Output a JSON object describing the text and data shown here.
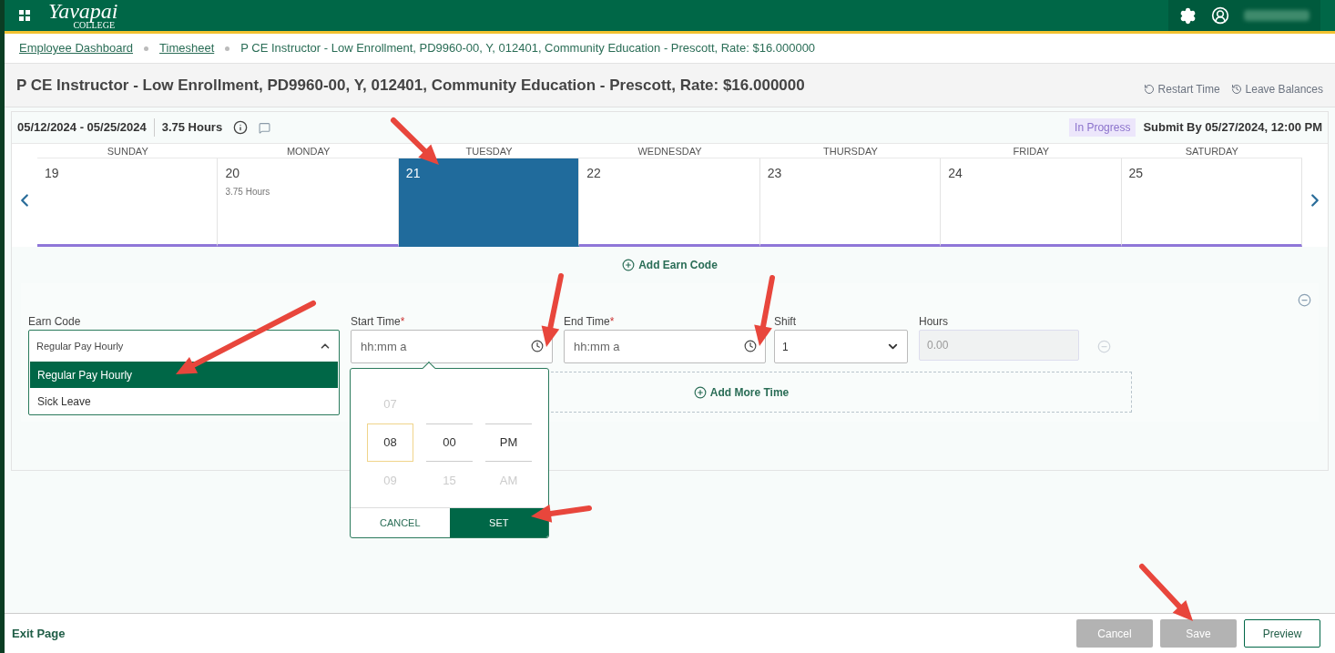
{
  "header": {
    "logo_main": "Yavapai",
    "logo_sub": "COLLEGE"
  },
  "breadcrumbs": [
    {
      "label": "Employee Dashboard",
      "link": true
    },
    {
      "label": "Timesheet",
      "link": true
    },
    {
      "label": "P CE Instructor - Low Enrollment, PD9960-00, Y, 012401, Community Education - Prescott, Rate: $16.000000",
      "link": false
    }
  ],
  "title": "P CE Instructor - Low Enrollment, PD9960-00, Y, 012401, Community Education - Prescott, Rate: $16.000000",
  "title_actions": [
    {
      "kind": "restart",
      "label": "Restart Time"
    },
    {
      "kind": "balances",
      "label": "Leave Balances"
    }
  ],
  "period": {
    "range": "05/12/2024 - 05/25/2024",
    "hours": "3.75 Hours",
    "status": "In Progress",
    "submit_by": "Submit By 05/27/2024, 12:00 PM"
  },
  "days": [
    {
      "weekday": "SUNDAY",
      "date": "19",
      "selected": false
    },
    {
      "weekday": "MONDAY",
      "date": "20",
      "hours": "3.75 Hours",
      "selected": false
    },
    {
      "weekday": "TUESDAY",
      "date": "21",
      "selected": true
    },
    {
      "weekday": "WEDNESDAY",
      "date": "22",
      "selected": false
    },
    {
      "weekday": "THURSDAY",
      "date": "23",
      "selected": false
    },
    {
      "weekday": "FRIDAY",
      "date": "24",
      "selected": false
    },
    {
      "weekday": "SATURDAY",
      "date": "25",
      "selected": false
    }
  ],
  "add_earn_code": "Add Earn Code",
  "earn_code": {
    "label": "Earn Code",
    "value": "Regular Pay Hourly",
    "expanded": true,
    "options": [
      {
        "label": "Regular Pay Hourly",
        "selected": true
      },
      {
        "label": "Sick Leave",
        "selected": false
      }
    ]
  },
  "start_time": {
    "label": "Start Time",
    "required_mark": "*",
    "placeholder": "hh:mm a"
  },
  "end_time": {
    "label": "End Time",
    "required_mark": "*",
    "placeholder": "hh:mm a"
  },
  "time_picker": {
    "columns": [
      [
        {
          "text": "07",
          "selected": false
        },
        {
          "text": "08",
          "selected": true
        },
        {
          "text": "09",
          "selected": false
        }
      ],
      [
        {
          "text": "00",
          "selected": true
        },
        {
          "text": "15",
          "selected": false
        }
      ],
      [
        {
          "text": "PM",
          "selected": true
        },
        {
          "text": "AM",
          "selected": false
        }
      ]
    ],
    "cancel": "CANCEL",
    "set": "SET"
  },
  "shift": {
    "label": "Shift",
    "value": "1"
  },
  "hours_field": {
    "label": "Hours",
    "value": "0.00",
    "disabled": true
  },
  "add_more_time": "Add More Time",
  "footer": {
    "exit": "Exit Page",
    "buttons": [
      {
        "label": "Cancel",
        "disabled": true
      },
      {
        "label": "Save",
        "disabled": true
      },
      {
        "label": "Preview",
        "disabled": false
      }
    ]
  }
}
